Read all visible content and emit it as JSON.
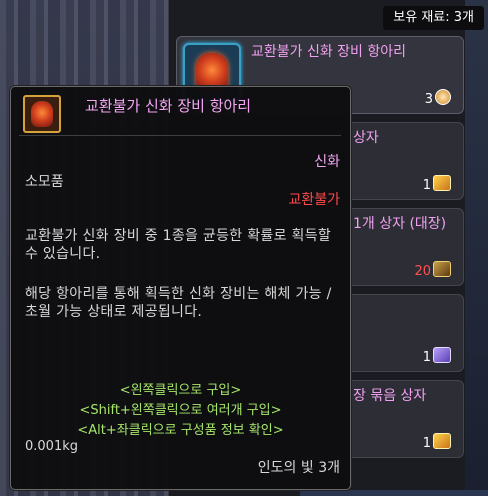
{
  "shop": {
    "material_count": "보유 재료: 3개",
    "items": [
      {
        "name": "교환불가 신화 장비 항아리",
        "price": "3",
        "currency_icon": "orb-icon"
      },
      {
        "name": "상자",
        "price": "1",
        "currency_icon": "gold-coin-icon"
      },
      {
        "name": "1개 상자 (대장)",
        "price": "20",
        "currency_icon": "chest-icon"
      },
      {
        "name": "",
        "price": "1",
        "currency_icon": "purple-coin-icon"
      },
      {
        "name": "장 묶음 상자",
        "price": "1",
        "currency_icon": "gold-coin-icon"
      }
    ]
  },
  "tooltip": {
    "title": "교환불가 신화 장비 항아리",
    "grade": "신화",
    "type": "소모품",
    "trade": "교환불가",
    "desc1": "교환불가 신화 장비 중 1종을 균등한 확률로 획득할 수 있습니다.",
    "desc2": "해당 항아리를 통해 획득한 신화 장비는 해체 가능 / 초월 가능 상태로 제공됩니다.",
    "action1": "<왼쪽클릭으로 구입>",
    "action2": "<Shift+왼쪽클릭으로 여러개 구입>",
    "action3": "<Alt+좌클릭으로 구성품 정보 확인>",
    "weight": "0.001kg",
    "cost": "인도의 빛 3개"
  },
  "colors": {
    "mythic": "#f3a6f3",
    "untradeable": "#ff4a4a",
    "action": "#a6e66a"
  }
}
